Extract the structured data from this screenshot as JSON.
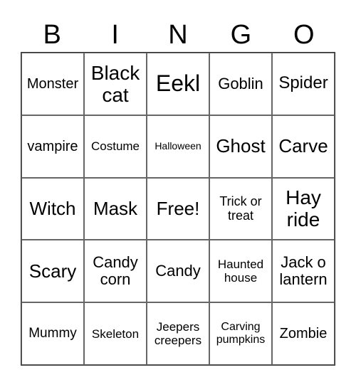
{
  "header": [
    "B",
    "I",
    "N",
    "G",
    "O"
  ],
  "cells": [
    [
      "Monster",
      "Black cat",
      "Eekl",
      "Goblin",
      "Spider"
    ],
    [
      "vampire",
      "Costume",
      "Halloween",
      "Ghost",
      "Carve"
    ],
    [
      "Witch",
      "Mask",
      "Free!",
      "Trick or treat",
      "Hay ride"
    ],
    [
      "Scary",
      "Candy corn",
      "Candy",
      "Haunted house",
      "Jack o lantern"
    ],
    [
      "Mummy",
      "Skeleton",
      "Jeepers creepers",
      "Carving pumpkins",
      "Zombie"
    ]
  ]
}
